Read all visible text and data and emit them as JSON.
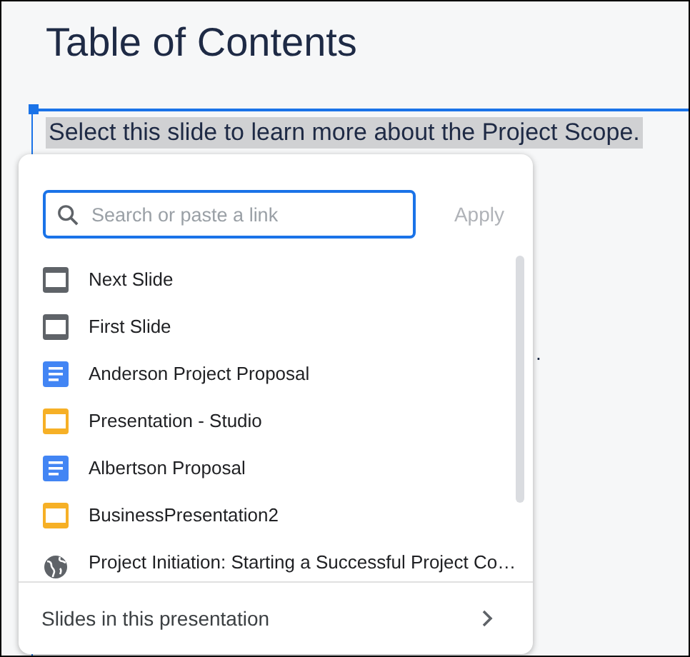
{
  "slide": {
    "title": "Table of Contents",
    "selected_text": "Select this slide to learn more about the Project Scope.",
    "text_fragment": "."
  },
  "link_popup": {
    "search": {
      "placeholder": "Search or paste a link"
    },
    "apply_button": {
      "label": "Apply",
      "disabled": true
    },
    "items": [
      {
        "kind": "slide",
        "label": "Next Slide"
      },
      {
        "kind": "slide",
        "label": "First Slide"
      },
      {
        "kind": "doc",
        "label": "Anderson Project Proposal"
      },
      {
        "kind": "presentation",
        "label": "Presentation - Studio"
      },
      {
        "kind": "doc",
        "label": "Albertson Proposal"
      },
      {
        "kind": "presentation",
        "label": "BusinessPresentation2"
      },
      {
        "kind": "web",
        "label": "Project Initiation: Starting a Successful Project Co…"
      }
    ],
    "footer": {
      "label": "Slides in this presentation"
    }
  }
}
